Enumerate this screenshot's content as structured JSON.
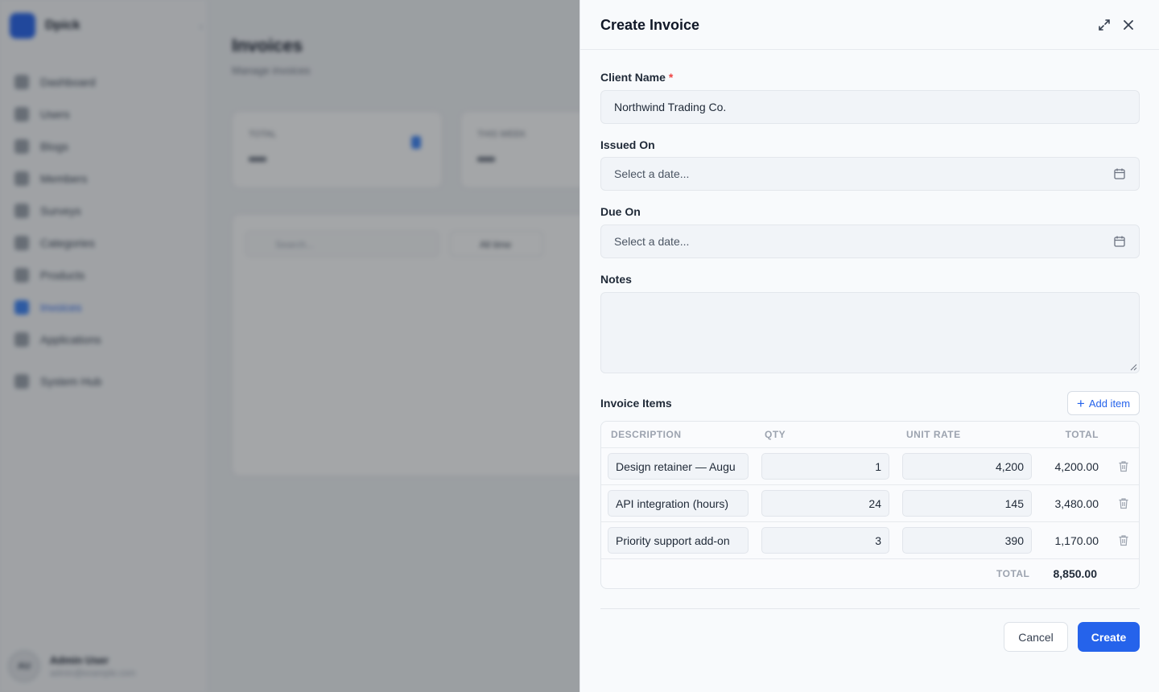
{
  "app": {
    "brand": "Dpick",
    "nav": [
      {
        "label": "Dashboard",
        "icon": "dashboard-icon"
      },
      {
        "label": "Users",
        "icon": "users-icon"
      },
      {
        "label": "Blogs",
        "icon": "blogs-icon"
      },
      {
        "label": "Members",
        "icon": "members-icon"
      },
      {
        "label": "Surveys",
        "icon": "surveys-icon"
      },
      {
        "label": "Categories",
        "icon": "categories-icon"
      },
      {
        "label": "Products",
        "icon": "products-icon"
      },
      {
        "label": "Invoices",
        "icon": "invoices-icon",
        "active": true
      },
      {
        "label": "Applications",
        "icon": "applications-icon"
      },
      {
        "label": "System Hub",
        "icon": "system-hub-icon"
      }
    ],
    "user": {
      "initials": "AU",
      "name": "Admin User",
      "email": "admin@example.com"
    },
    "page": {
      "title": "Invoices",
      "subtitle": "Manage invoices"
    },
    "stats": [
      {
        "label": "TOTAL"
      },
      {
        "label": "THIS WEEK"
      }
    ],
    "search_placeholder": "Search...",
    "filter_label": "All time"
  },
  "drawer": {
    "title": "Create Invoice",
    "client_label": "Client Name",
    "required_mark": "*",
    "client_value": "Northwind Trading Co.",
    "issued_label": "Issued On",
    "issued_placeholder": "Select a date...",
    "due_label": "Due On",
    "due_placeholder": "Select a date...",
    "notes_label": "Notes",
    "notes_value": "",
    "items_title": "Invoice Items",
    "add_item_label": "Add item",
    "columns": {
      "description": "DESCRIPTION",
      "qty": "QTY",
      "rate": "UNIT RATE",
      "total": "TOTAL"
    },
    "items": [
      {
        "description": "Design retainer — Augu",
        "qty": "1",
        "rate": "4,200",
        "total": "4,200.00"
      },
      {
        "description": "API integration (hours)",
        "qty": "24",
        "rate": "145",
        "total": "3,480.00"
      },
      {
        "description": "Priority support add-on",
        "qty": "3",
        "rate": "390",
        "total": "1,170.00"
      }
    ],
    "grand_total_label": "TOTAL",
    "grand_total_value": "8,850.00",
    "cancel_label": "Cancel",
    "create_label": "Create"
  },
  "colors": {
    "accent": "#2563eb",
    "required": "#ef4444"
  }
}
